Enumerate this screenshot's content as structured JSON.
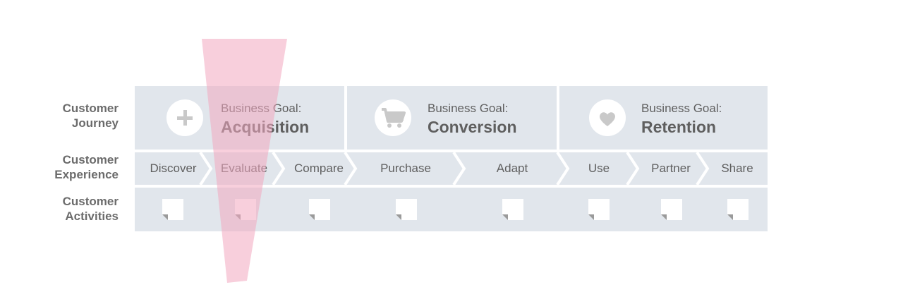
{
  "row_labels": {
    "journey": [
      "Customer",
      "Journey"
    ],
    "experience": [
      "Customer",
      "Experience"
    ],
    "activities": [
      "Customer",
      "Activities"
    ]
  },
  "goals": [
    {
      "kicker": "Business Goal:",
      "name": "Acquisition",
      "icon": "plus-icon"
    },
    {
      "kicker": "Business Goal:",
      "name": "Conversion",
      "icon": "cart-icon"
    },
    {
      "kicker": "Business Goal:",
      "name": "Retention",
      "icon": "heart-icon"
    }
  ],
  "stages": [
    "Discover",
    "Evaluate",
    "Compare",
    "Purchase",
    "Adapt",
    "Use",
    "Partner",
    "Share"
  ],
  "activity_notes": [
    "note-icon",
    "note-icon",
    "note-icon",
    "note-icon",
    "note-icon",
    "note-icon",
    "note-icon",
    "note-icon"
  ],
  "colors": {
    "panel": "#e1e6ec",
    "text": "#5f5f5f",
    "label": "#6b6b6b",
    "funnel": "#f2a7bf",
    "icon": "#c9c9c9"
  }
}
